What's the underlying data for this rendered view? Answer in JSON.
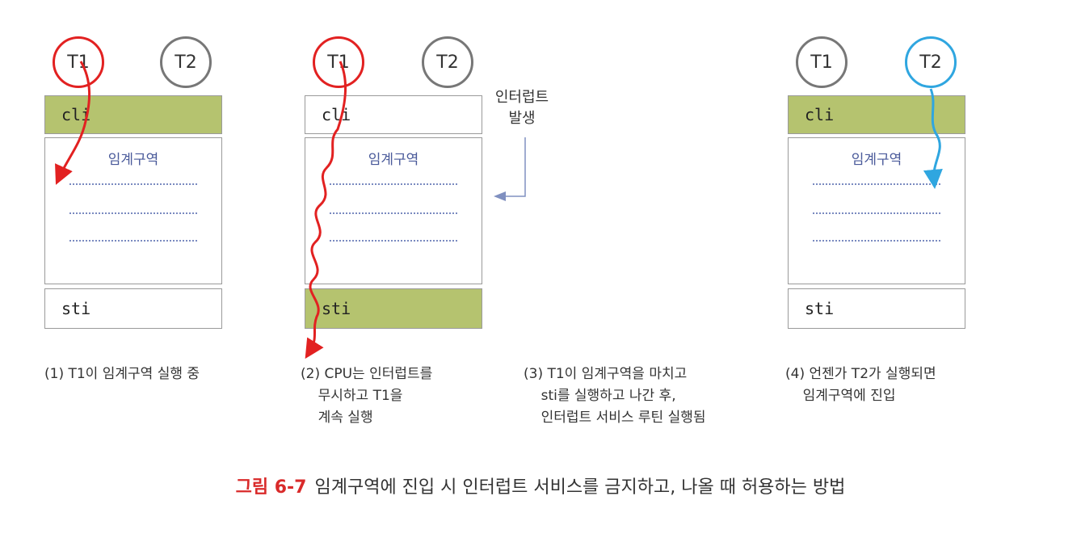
{
  "threads": {
    "t1": "T1",
    "t2": "T2"
  },
  "code": {
    "cli": "cli",
    "sti": "sti"
  },
  "critical_section": "임계구역",
  "interrupt_note": [
    "인터럽트",
    "발생"
  ],
  "captions": [
    "(1) T1이 임계구역 실행 중",
    "(2) CPU는 인터럽트를\n    무시하고 T1을\n    계속 실행",
    "(3) T1이 임계구역을 마치고\n    sti를 실행하고 나간 후,\n    인터럽트 서비스 루틴 실행됨",
    "(4) 언젠가 T2가 실행되면\n    임계구역에 진입"
  ],
  "figure": {
    "number": "그림 6-7",
    "title": "임계구역에 진입 시 인터럽트 서비스를 금지하고, 나올 때 허용하는 방법"
  },
  "colors": {
    "active_red": "#e22121",
    "active_blue": "#2fa6e0",
    "block_green": "#b5c36f"
  }
}
